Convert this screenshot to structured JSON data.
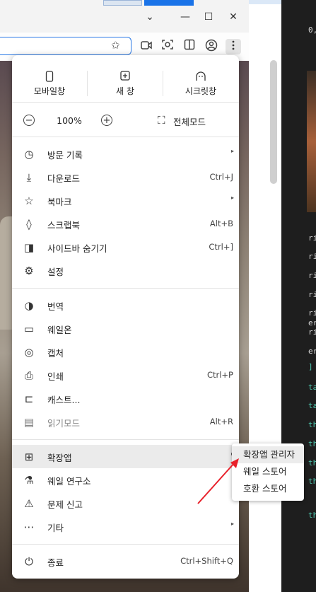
{
  "editor": {
    "lines": [
      {
        "text": "0,",
        "cyan": false
      },
      {
        "text": "ript",
        "cyan": false
      },
      {
        "text": "ript",
        "cyan": false
      },
      {
        "text": "ript",
        "cyan": false
      },
      {
        "text": "ript",
        "cyan": false
      },
      {
        "text": "ript",
        "cyan": false
      },
      {
        "text": "eri",
        "cyan": false
      },
      {
        "text": "ript",
        "cyan": false
      },
      {
        "text": "eri",
        "cyan": false
      },
      {
        "text": "] c",
        "cyan": true
      },
      {
        "text": "ta",
        "cyan": true
      },
      {
        "text": "ta",
        "cyan": true
      },
      {
        "text": "th",
        "cyan": true
      },
      {
        "text": "th",
        "cyan": true
      },
      {
        "text": "th",
        "cyan": true
      },
      {
        "text": "th",
        "cyan": true
      },
      {
        "text": "th",
        "cyan": true
      }
    ]
  },
  "window": {
    "minimize": "—",
    "maximize": "☐",
    "close": "✕",
    "dropdown": "⌄"
  },
  "toolbar": {
    "favorite_icon": "✩",
    "icons": [
      "video-icon",
      "capture-icon",
      "sidebar-icon",
      "profile-icon",
      "more-icon"
    ]
  },
  "menu": {
    "top_buttons": [
      {
        "label": "모바일창",
        "icon": "▯",
        "name": "mobile-window"
      },
      {
        "label": "새 창",
        "icon": "⊞",
        "name": "new-window"
      },
      {
        "label": "시크릿창",
        "icon": "◓",
        "name": "secret-window"
      }
    ],
    "zoom": {
      "minus": "−",
      "value": "100%",
      "plus": "+",
      "fullscreen_label": "전체모드",
      "fullscreen_icon": "⛶"
    },
    "group1": [
      {
        "label": "방문 기록",
        "icon": "◷",
        "shortcut": "",
        "arrow": true,
        "name": "history"
      },
      {
        "label": "다운로드",
        "icon": "⤓",
        "shortcut": "Ctrl+J",
        "arrow": false,
        "name": "downloads"
      },
      {
        "label": "북마크",
        "icon": "☆",
        "shortcut": "",
        "arrow": true,
        "name": "bookmarks"
      },
      {
        "label": "스크랩북",
        "icon": "◊",
        "shortcut": "Alt+B",
        "arrow": false,
        "name": "scrapbook"
      },
      {
        "label": "사이드바 숨기기",
        "icon": "◨",
        "shortcut": "Ctrl+]",
        "arrow": false,
        "name": "hide-sidebar"
      },
      {
        "label": "설정",
        "icon": "⚙",
        "shortcut": "",
        "arrow": false,
        "name": "settings"
      }
    ],
    "group2": [
      {
        "label": "번역",
        "icon": "◑",
        "shortcut": "",
        "arrow": false,
        "name": "translate",
        "dim": false
      },
      {
        "label": "웨일온",
        "icon": "▭",
        "shortcut": "",
        "arrow": false,
        "name": "whaleon",
        "dim": false
      },
      {
        "label": "캡처",
        "icon": "◎",
        "shortcut": "",
        "arrow": false,
        "name": "capture",
        "dim": false
      },
      {
        "label": "인쇄",
        "icon": "⎙",
        "shortcut": "Ctrl+P",
        "arrow": false,
        "name": "print",
        "dim": false
      },
      {
        "label": "캐스트...",
        "icon": "⊏",
        "shortcut": "",
        "arrow": false,
        "name": "cast",
        "dim": false
      },
      {
        "label": "읽기모드",
        "icon": "▤",
        "shortcut": "Alt+R",
        "arrow": false,
        "name": "reader-mode",
        "dim": true
      }
    ],
    "group3": [
      {
        "label": "확장앱",
        "icon": "⊞",
        "shortcut": "",
        "arrow": true,
        "name": "extensions",
        "highlight": true
      },
      {
        "label": "웨일 연구소",
        "icon": "⚗",
        "shortcut": "",
        "arrow": false,
        "name": "whale-lab",
        "highlight": false
      },
      {
        "label": "문제 신고",
        "icon": "⚠",
        "shortcut": "",
        "arrow": false,
        "name": "report-issue",
        "highlight": false
      },
      {
        "label": "기타",
        "icon": "⋯",
        "shortcut": "",
        "arrow": true,
        "name": "more-tools",
        "highlight": false
      }
    ],
    "quit": {
      "label": "종료",
      "icon": "⏻",
      "shortcut": "Ctrl+Shift+Q"
    }
  },
  "submenu": {
    "items": [
      {
        "label": "확장앱 관리자",
        "highlight": true,
        "name": "extension-manager"
      },
      {
        "label": "웨일 스토어",
        "highlight": false,
        "name": "whale-store"
      },
      {
        "label": "호환 스토어",
        "highlight": false,
        "name": "compatible-store"
      }
    ]
  },
  "colors": {
    "accent": "#2a79e6",
    "arrow": "#e8202a",
    "highlight": "#ebebeb"
  }
}
